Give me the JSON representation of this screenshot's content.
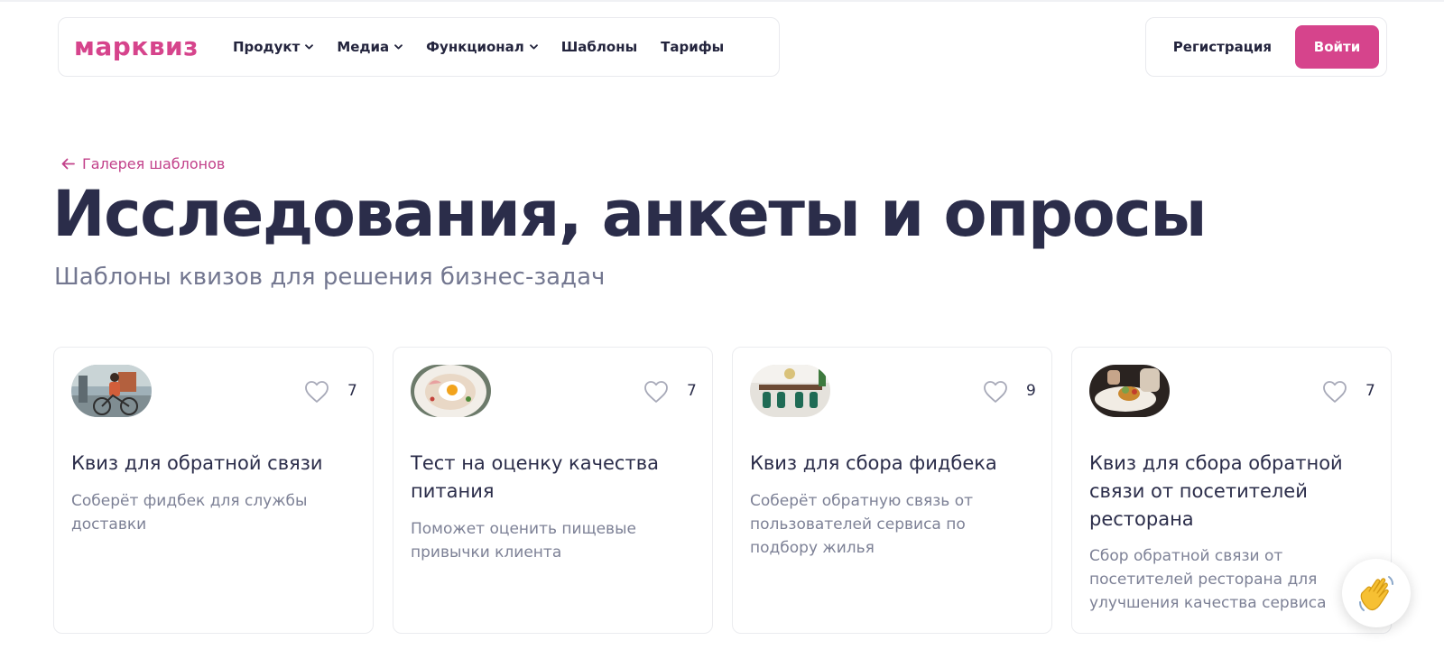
{
  "header": {
    "logo": "марквиз",
    "nav": [
      {
        "label": "Продукт",
        "dropdown": true
      },
      {
        "label": "Медиа",
        "dropdown": true
      },
      {
        "label": "Функционал",
        "dropdown": true
      },
      {
        "label": "Шаблоны",
        "dropdown": false
      },
      {
        "label": "Тарифы",
        "dropdown": false
      }
    ],
    "register_label": "Регистрация",
    "login_label": "Войти"
  },
  "breadcrumb": {
    "label": "Галерея шаблонов"
  },
  "page": {
    "title": "Исследования, анкеты и опросы",
    "subtitle": "Шаблоны квизов для решения бизнес-задач"
  },
  "cards": [
    {
      "image": "courier-bicycle-photo",
      "likes": "7",
      "title": "Квиз для обратной связи",
      "description": "Соберёт фидбек для службы доставки"
    },
    {
      "image": "breakfast-plate-photo",
      "likes": "7",
      "title": "Тест на оценку качества питания",
      "description": "Поможет оценить пищевые привычки клиента"
    },
    {
      "image": "dining-room-interior-photo",
      "likes": "9",
      "title": "Квиз для сбора фидбека",
      "description": "Соберёт обратную связь от пользователей сервиса по подбору жилья"
    },
    {
      "image": "chef-plating-dish-photo",
      "likes": "7",
      "title": "Квиз для сбора обратной связи от посетителей ресторана",
      "description": "Сбор обратной связи от посетителей ресторана для улучшения качества сервиса"
    }
  ],
  "colors": {
    "brand": "#d6448c",
    "title": "#2b2d4a",
    "muted": "#7d8196",
    "border": "#ebecef"
  },
  "icons": {
    "back": "arrow-left-icon",
    "like": "heart-icon",
    "chat": "waving-hand-icon"
  }
}
